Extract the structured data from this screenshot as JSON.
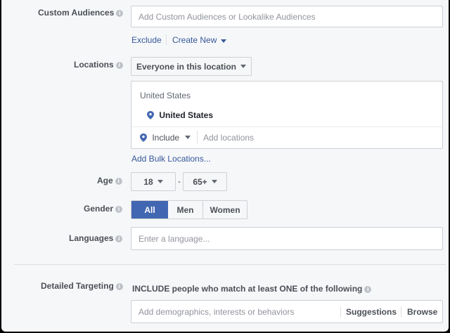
{
  "custom_audiences": {
    "label": "Custom Audiences",
    "placeholder": "Add Custom Audiences or Lookalike Audiences",
    "exclude_link": "Exclude",
    "create_new_link": "Create New"
  },
  "locations": {
    "label": "Locations",
    "dropdown_value": "Everyone in this location",
    "group_header": "United States",
    "selected_location": "United States",
    "include_value": "Include",
    "add_placeholder": "Add locations",
    "bulk_link": "Add Bulk Locations..."
  },
  "age": {
    "label": "Age",
    "min": "18",
    "separator": "-",
    "max": "65+"
  },
  "gender": {
    "label": "Gender",
    "options": [
      "All",
      "Men",
      "Women"
    ],
    "selected": "All"
  },
  "languages": {
    "label": "Languages",
    "placeholder": "Enter a language..."
  },
  "detailed_targeting": {
    "label": "Detailed Targeting",
    "description": "INCLUDE people who match at least ONE of the following",
    "placeholder": "Add demographics, interests or behaviors",
    "suggestions": "Suggestions",
    "browse": "Browse"
  },
  "colors": {
    "page_bg": "#f6f7f9",
    "accent": "#4267b2",
    "link": "#365899",
    "pin": "#4267b2"
  }
}
